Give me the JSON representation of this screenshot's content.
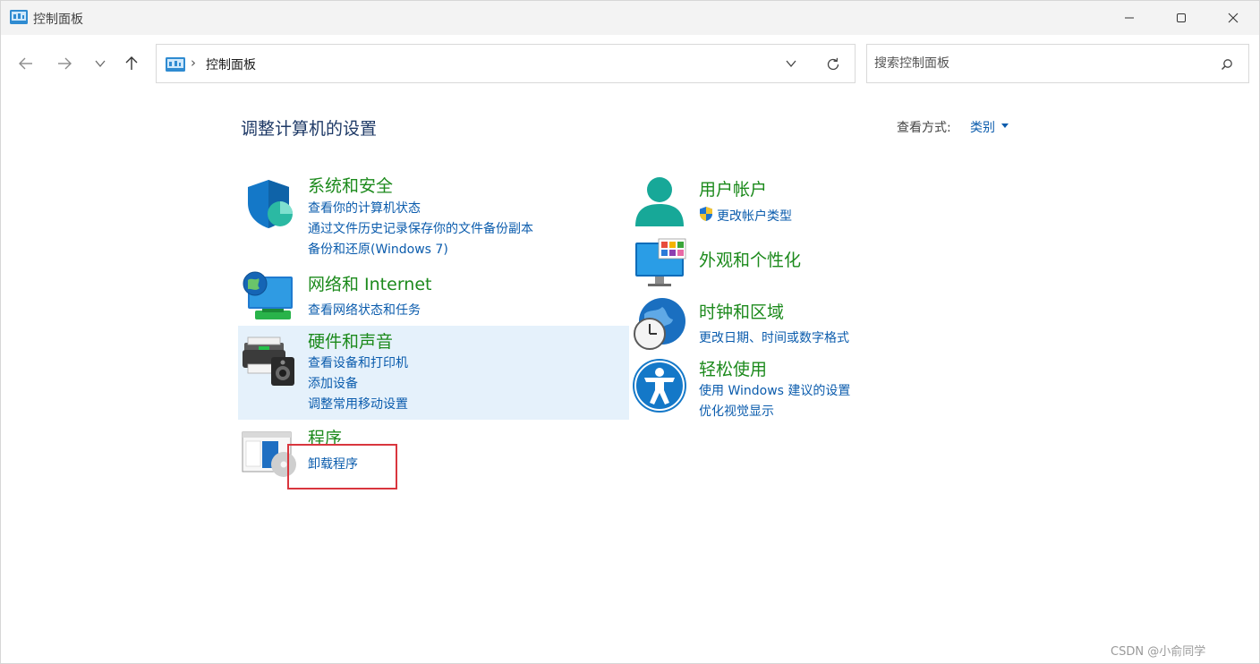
{
  "window": {
    "title": "控制面板"
  },
  "nav": {
    "address_text": "控制面板",
    "search_placeholder": "搜索控制面板"
  },
  "content": {
    "heading": "调整计算机的设置",
    "view_by_label": "查看方式:",
    "view_by_value": "类别",
    "left_categories": [
      {
        "title": "系统和安全",
        "links": [
          "查看你的计算机状态",
          "通过文件历史记录保存你的文件备份副本",
          "备份和还原(Windows 7)"
        ]
      },
      {
        "title": "网络和 Internet",
        "links": [
          "查看网络状态和任务"
        ]
      },
      {
        "title": "硬件和声音",
        "links": [
          "查看设备和打印机",
          "添加设备",
          "调整常用移动设置"
        ]
      },
      {
        "title": "程序",
        "links": [
          "卸载程序"
        ]
      }
    ],
    "right_categories": [
      {
        "title": "用户帐户",
        "links": [
          "更改帐户类型"
        ]
      },
      {
        "title": "外观和个性化",
        "links": []
      },
      {
        "title": "时钟和区域",
        "links": [
          "更改日期、时间或数字格式"
        ]
      },
      {
        "title": "轻松使用",
        "links": [
          "使用 Windows 建议的设置",
          "优化视觉显示"
        ]
      }
    ]
  },
  "watermark": "CSDN @小俞同学"
}
